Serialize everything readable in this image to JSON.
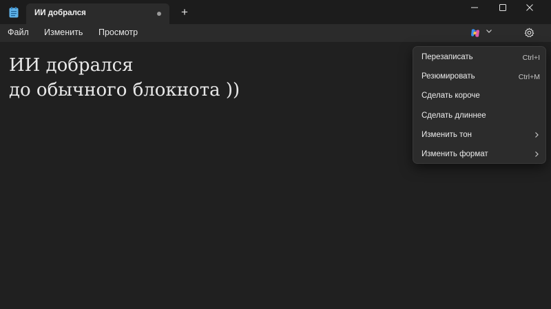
{
  "tab": {
    "title": "ИИ добрался"
  },
  "titlebar": {
    "new_tab": "+"
  },
  "menu": {
    "file": "Файл",
    "edit": "Изменить",
    "view": "Просмотр"
  },
  "document": {
    "text": "ИИ добрался\nдо обычного блокнота ))"
  },
  "dropdown": {
    "items": [
      {
        "label": "Перезаписать",
        "shortcut": "Ctrl+I"
      },
      {
        "label": "Резюмировать",
        "shortcut": "Ctrl+M"
      },
      {
        "label": "Сделать короче"
      },
      {
        "label": "Сделать длиннее"
      },
      {
        "label": "Изменить тон"
      },
      {
        "label": "Изменить формат"
      }
    ]
  },
  "icons": {
    "app": "notepad-icon",
    "copilot": "copilot-icon",
    "settings": "gear-icon"
  },
  "colors": {
    "background": "#202020",
    "titlebar": "#1c1c1c",
    "menubar": "#2b2b2b",
    "dropdown": "#2c2c2c",
    "text": "#e8e8e8"
  }
}
